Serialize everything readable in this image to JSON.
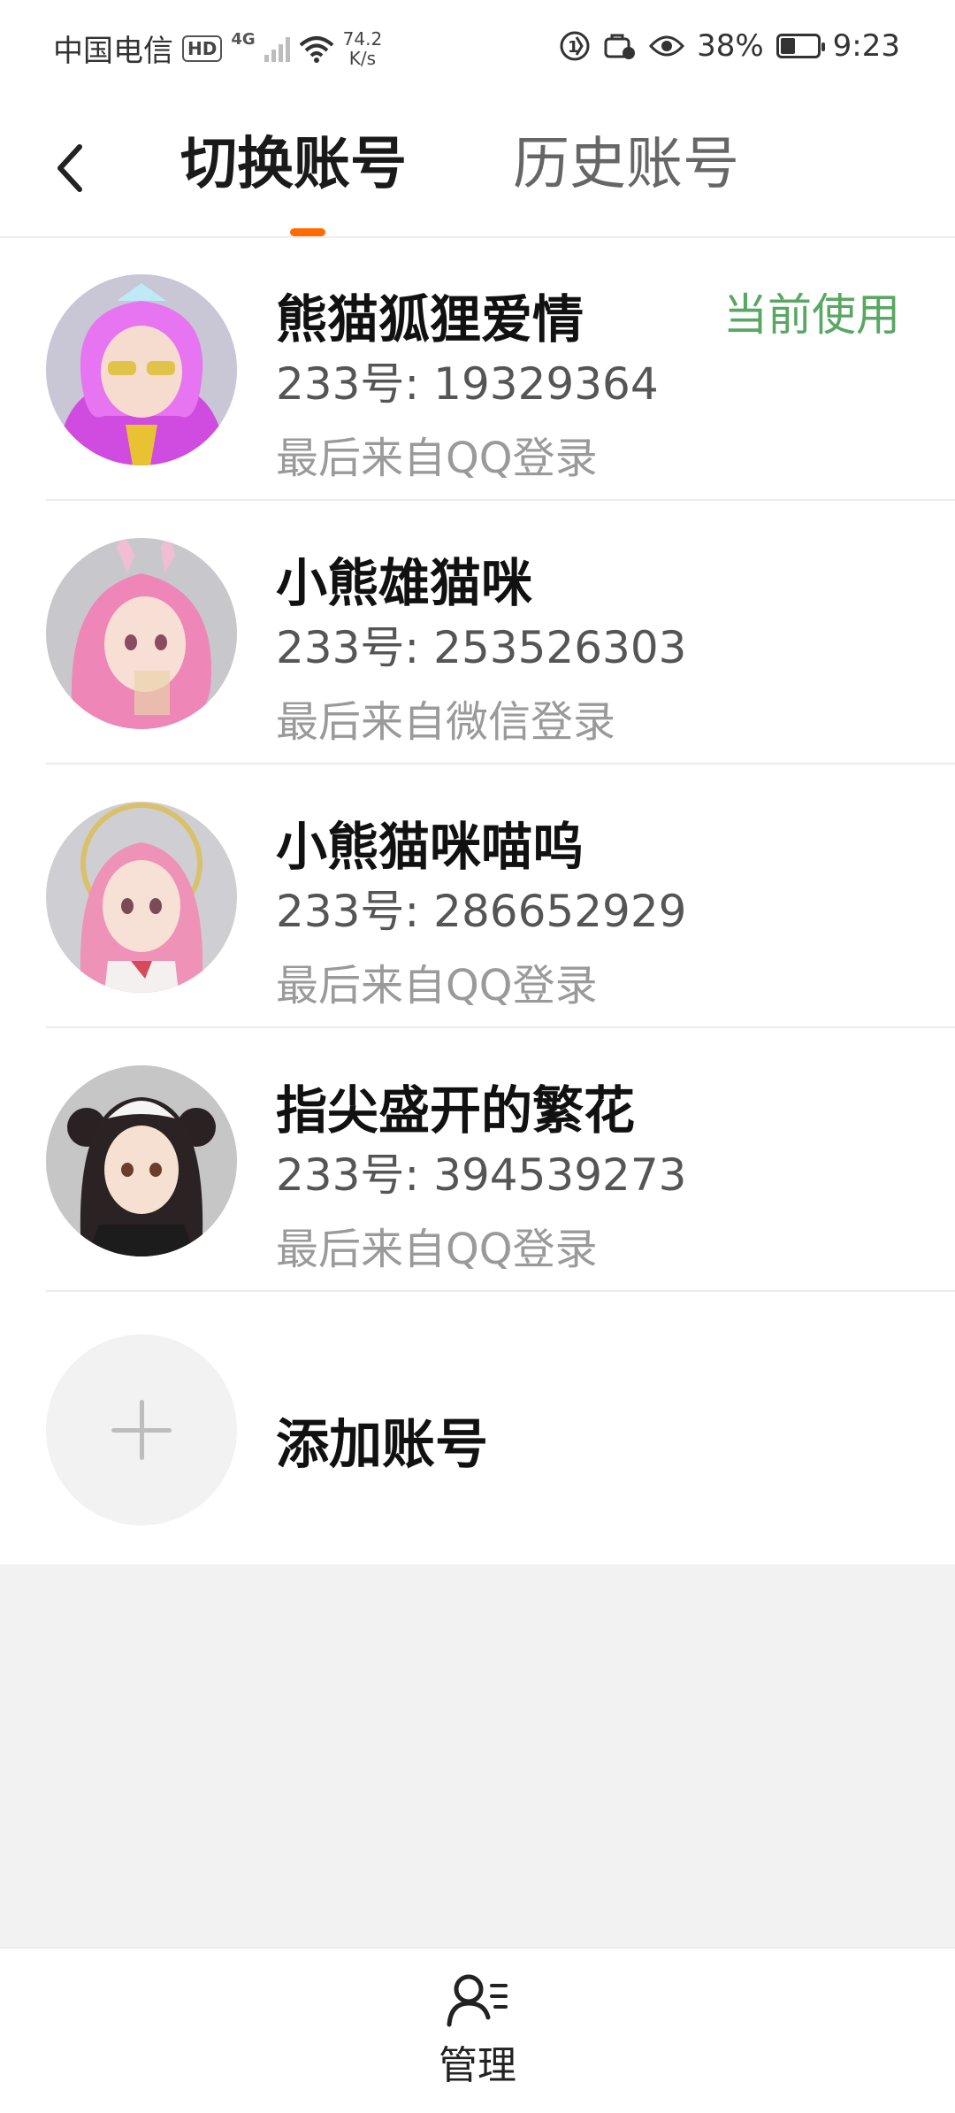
{
  "status_bar": {
    "carrier": "中国电信",
    "hd": "HD",
    "network": "4G",
    "speed_value": "74.2",
    "speed_unit": "K/s",
    "battery_percent": "38%",
    "battery_level": 0.38,
    "time": "9:23"
  },
  "header": {
    "tabs": [
      {
        "label": "切换账号",
        "active": true
      },
      {
        "label": "历史账号",
        "active": false
      }
    ],
    "accent_color": "#ff6b00"
  },
  "accounts": [
    {
      "name": "熊猫狐狸爱情",
      "id_line": "233号: 19329364",
      "source": "最后来自QQ登录",
      "current_label": "当前使用"
    },
    {
      "name": "小熊雄猫咪",
      "id_line": "233号: 253526303",
      "source": "最后来自微信登录"
    },
    {
      "name": "小熊猫咪喵呜",
      "id_line": "233号: 286652929",
      "source": "最后来自QQ登录"
    },
    {
      "name": "指尖盛开的繁花",
      "id_line": "233号: 394539273",
      "source": "最后来自QQ登录"
    }
  ],
  "add_account": {
    "label": "添加账号",
    "icon": "plus-icon"
  },
  "bottom_bar": {
    "manage_label": "管理",
    "icon": "user-manage-icon"
  },
  "colors": {
    "current_green": "#58a762"
  }
}
